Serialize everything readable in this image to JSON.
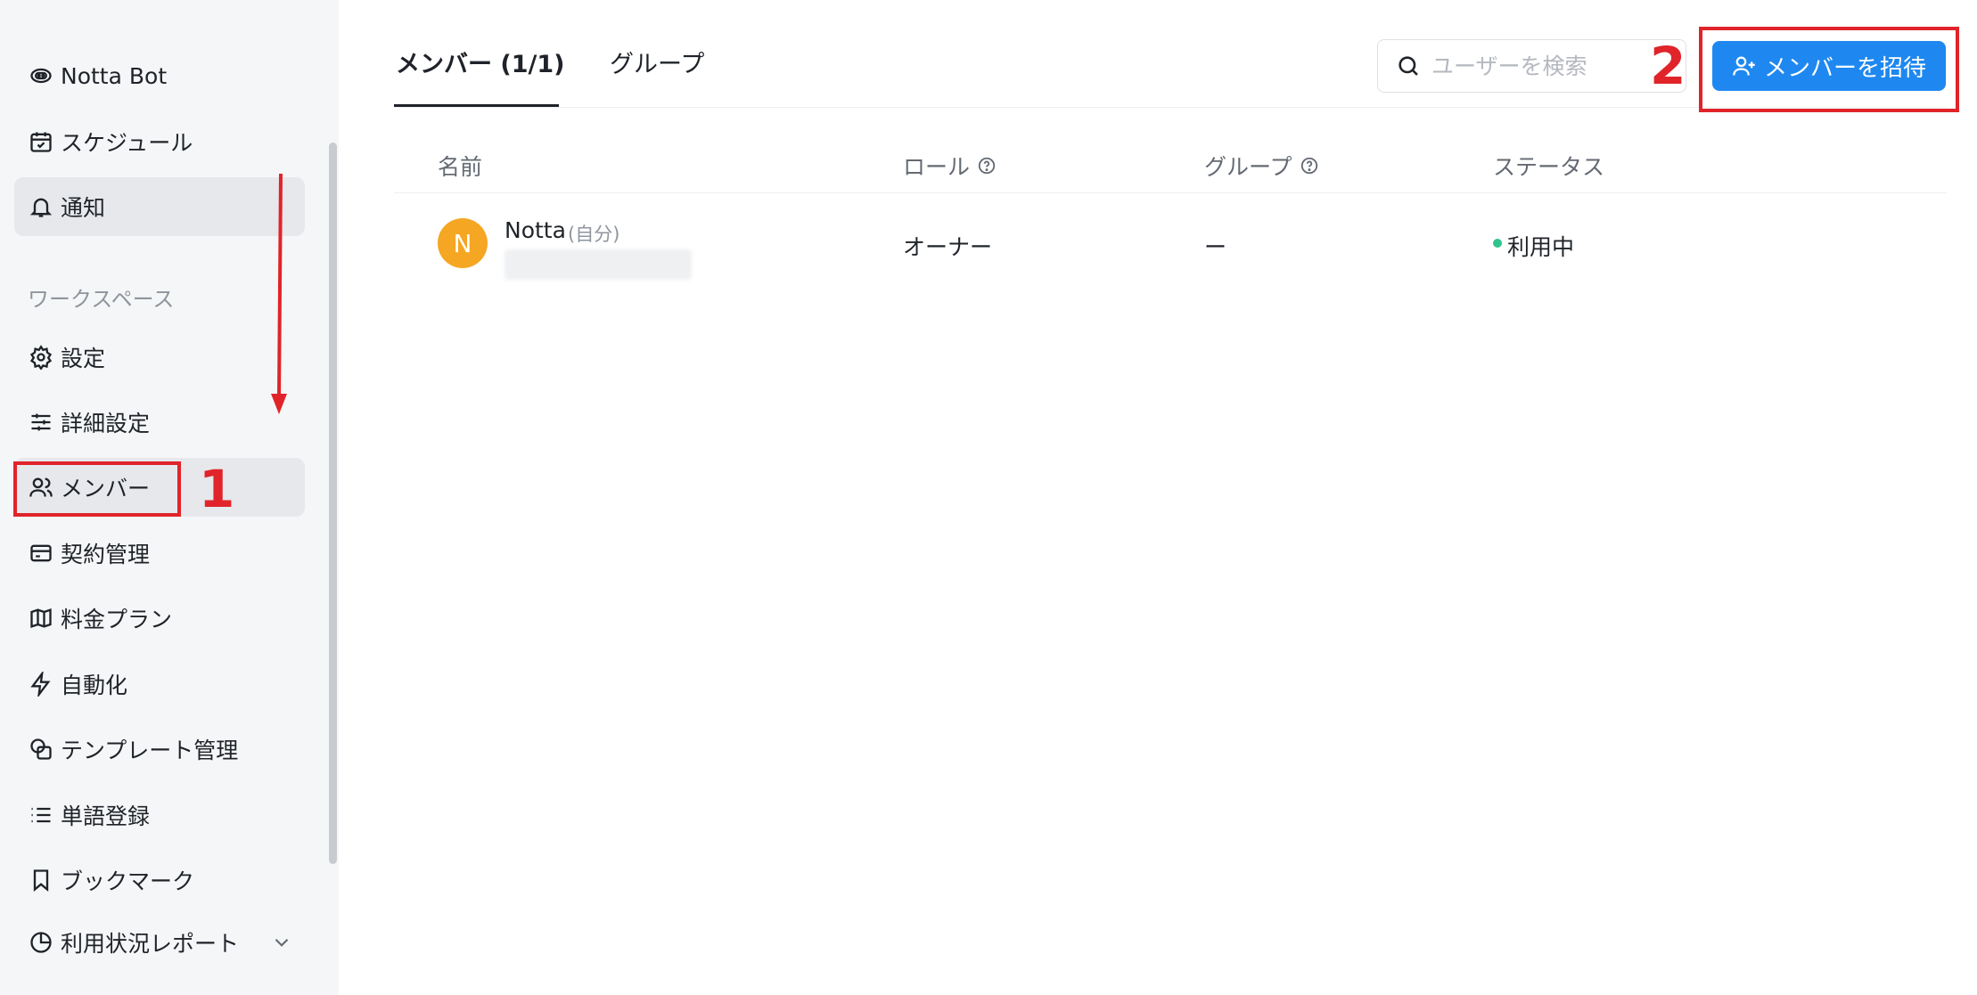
{
  "sidebar": {
    "items": [
      {
        "label": "Notta Bot",
        "icon": "bot-icon"
      },
      {
        "label": "スケジュール",
        "icon": "calendar-icon"
      },
      {
        "label": "通知",
        "icon": "bell-icon"
      }
    ],
    "section_label": "ワークスペース",
    "workspace_items": [
      {
        "label": "設定",
        "icon": "gear-icon"
      },
      {
        "label": "詳細設定",
        "icon": "sliders-icon"
      },
      {
        "label": "メンバー",
        "icon": "users-icon"
      },
      {
        "label": "契約管理",
        "icon": "card-icon"
      },
      {
        "label": "料金プラン",
        "icon": "map-icon"
      },
      {
        "label": "自動化",
        "icon": "bolt-icon"
      },
      {
        "label": "テンプレート管理",
        "icon": "template-icon"
      },
      {
        "label": "単語登録",
        "icon": "list-icon"
      },
      {
        "label": "ブックマーク",
        "icon": "bookmark-icon"
      },
      {
        "label": "利用状況レポート",
        "icon": "pie-chart-icon"
      }
    ]
  },
  "tabs": [
    {
      "label": "メンバー (1/1)",
      "active": true
    },
    {
      "label": "グループ",
      "active": false
    }
  ],
  "search": {
    "placeholder": "ユーザーを検索",
    "value": ""
  },
  "invite_button": {
    "label": "メンバーを招待"
  },
  "annotations": {
    "step1": "1",
    "step2": "2"
  },
  "table": {
    "columns": [
      "名前",
      "ロール",
      "グループ",
      "ステータス"
    ],
    "rows": [
      {
        "avatar": "N",
        "name": "Notta",
        "self_tag": "(自分)",
        "role": "オーナー",
        "group": "ー",
        "status": "利用中"
      }
    ]
  },
  "colors": {
    "accent": "#1e88f0",
    "annotation": "#e0242a",
    "avatar": "#f5a623",
    "status_active": "#2fc48d"
  }
}
